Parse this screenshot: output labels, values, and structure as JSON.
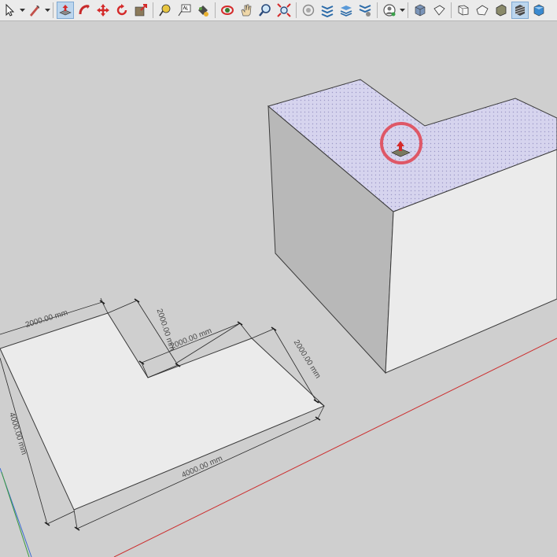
{
  "toolbar": {
    "tools": [
      {
        "id": "select",
        "icon": "select-arrow-icon"
      },
      {
        "id": "paint",
        "icon": "paint-bucket-icon"
      },
      {
        "id": "push-pull",
        "icon": "push-pull-icon",
        "active": true
      },
      {
        "id": "follow-me",
        "icon": "follow-me-icon"
      },
      {
        "id": "move",
        "icon": "move-icon"
      },
      {
        "id": "rotate",
        "icon": "rotate-icon"
      },
      {
        "id": "scale",
        "icon": "scale-icon"
      },
      {
        "id": "tape-measure",
        "icon": "tape-measure-icon"
      },
      {
        "id": "text",
        "icon": "text-icon"
      },
      {
        "id": "paint-2",
        "icon": "paint-bucket-icon"
      },
      {
        "id": "orbit",
        "icon": "orbit-icon"
      },
      {
        "id": "pan",
        "icon": "pan-hand-icon"
      },
      {
        "id": "zoom",
        "icon": "zoom-icon"
      },
      {
        "id": "zoom-extents",
        "icon": "zoom-extents-icon"
      },
      {
        "id": "warehouse",
        "icon": "3d-warehouse-icon"
      },
      {
        "id": "sandbox",
        "icon": "sandbox-icon"
      },
      {
        "id": "layers",
        "icon": "layers-icon"
      },
      {
        "id": "sections",
        "icon": "section-plane-icon"
      },
      {
        "id": "account",
        "icon": "account-icon"
      },
      {
        "id": "iso-view",
        "icon": "iso-view-icon"
      },
      {
        "id": "top-view",
        "icon": "top-view-icon"
      },
      {
        "id": "front-view",
        "icon": "front-view-icon"
      },
      {
        "id": "right-view",
        "icon": "right-view-icon"
      },
      {
        "id": "back-view",
        "icon": "back-view-icon"
      },
      {
        "id": "shaded",
        "icon": "shaded-style-icon",
        "active": true
      },
      {
        "id": "textured",
        "icon": "textured-style-icon"
      }
    ]
  },
  "colors": {
    "background": "#cfcfcf",
    "top_face": "#d6d4ee",
    "front_face": "#ebebeb",
    "left_face": "#b8b8b8",
    "highlight_ring": "#e04a58",
    "red_axis": "#cc2f2f",
    "push_pull_accent": "#d42a2a"
  },
  "dimensions": {
    "left_top": "2000.00 mm",
    "notch_vertical": "2000.00 mm",
    "notch_horizontal": "2000.00 mm",
    "right_side": "2000.00 mm",
    "left_side": "4000.00 mm",
    "bottom": "4000.00 mm"
  }
}
